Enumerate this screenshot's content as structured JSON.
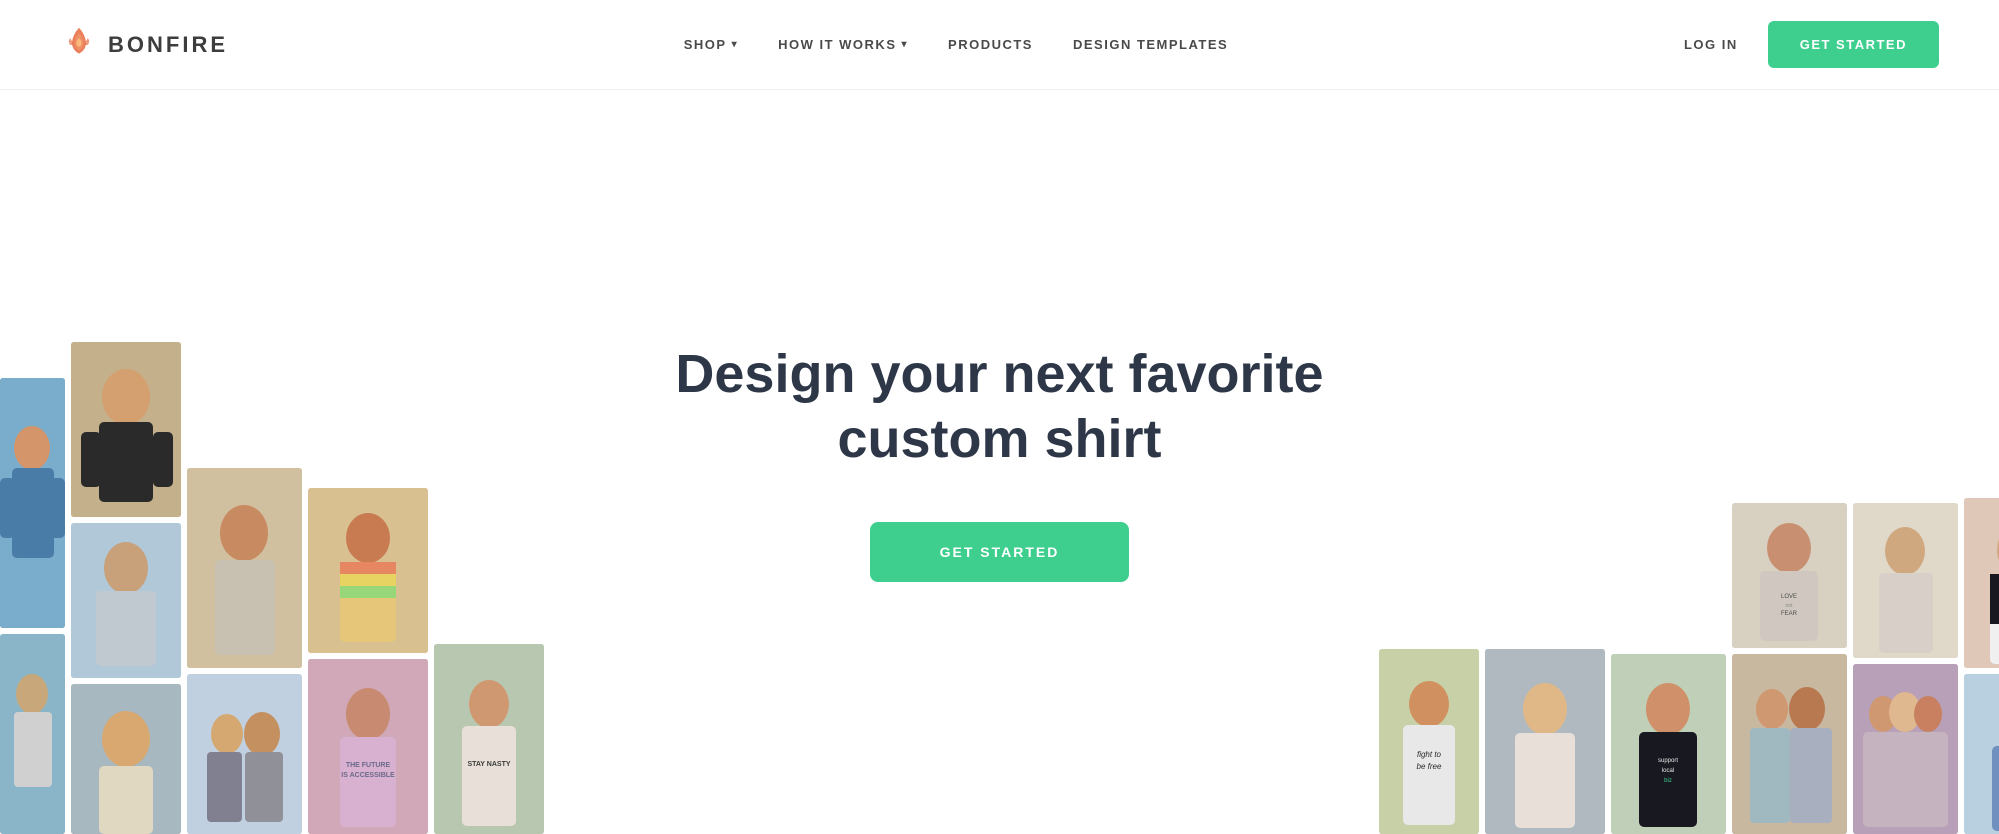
{
  "brand": {
    "name": "BONFIRE",
    "logo_alt": "Bonfire logo flame icon"
  },
  "nav": {
    "links": [
      {
        "label": "SHOP",
        "has_dropdown": true
      },
      {
        "label": "HOW IT WORKS",
        "has_dropdown": true
      },
      {
        "label": "PRODUCTS",
        "has_dropdown": false
      },
      {
        "label": "DESIGN TEMPLATES",
        "has_dropdown": false
      }
    ],
    "login_label": "LOG IN",
    "cta_label": "GET STARTED"
  },
  "hero": {
    "title_line1": "Design your next favorite",
    "title_line2": "custom shirt",
    "cta_label": "GET STARTED"
  },
  "colors": {
    "accent": "#3ecf8e",
    "text_dark": "#2d3748",
    "text_nav": "#4a4a4a"
  }
}
